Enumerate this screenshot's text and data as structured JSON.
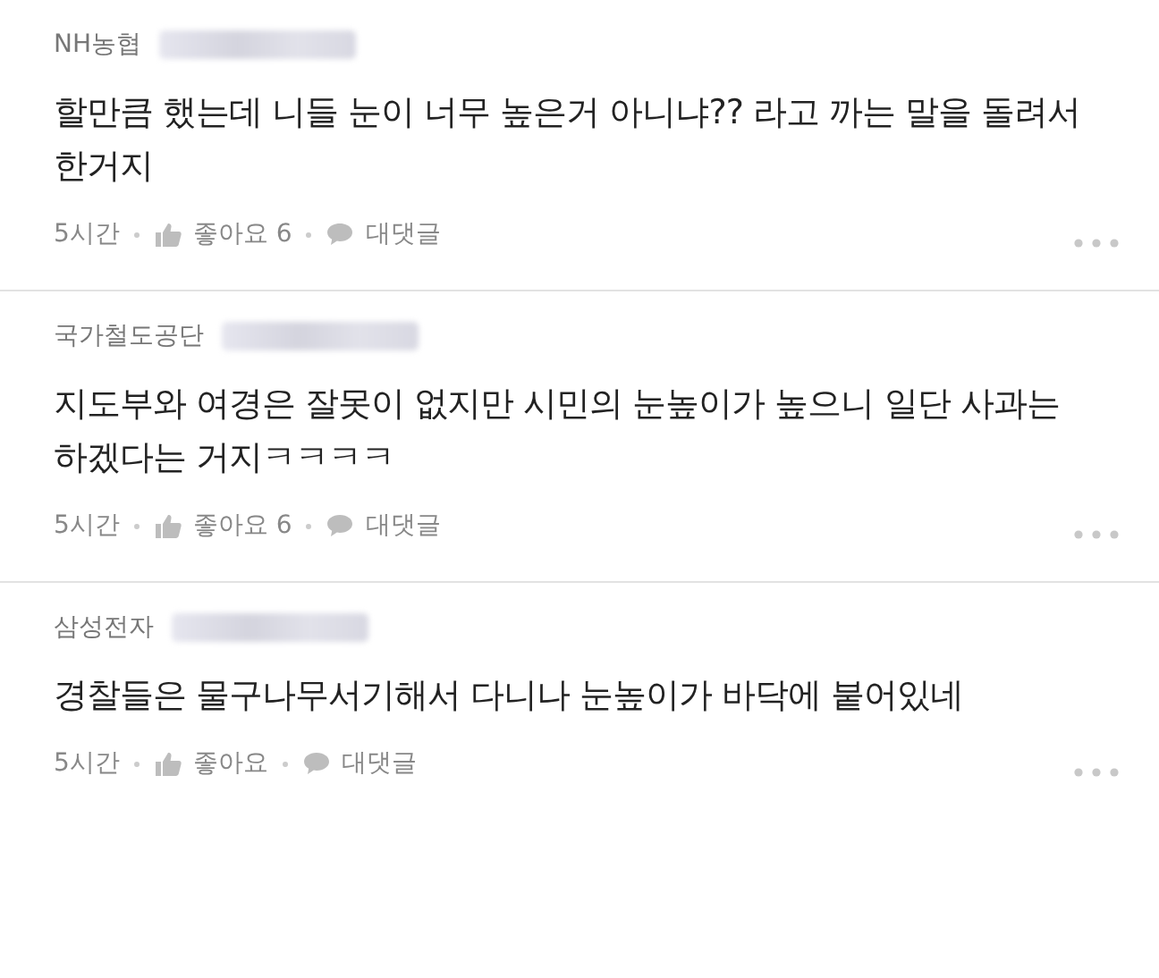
{
  "comments": [
    {
      "company": "NH농협",
      "text": "할만큼 했는데 니들 눈이 너무 높은거 아니냐?? 라고 까는 말을 돌려서 한거지",
      "time": "5시간",
      "likes": "좋아요 6",
      "reply": "대댓글"
    },
    {
      "company": "국가철도공단",
      "text": "지도부와 여경은 잘못이 없지만 시민의 눈높이가 높으니 일단 사과는 하겠다는 거지ㅋㅋㅋㅋ",
      "time": "5시간",
      "likes": "좋아요 6",
      "reply": "대댓글"
    },
    {
      "company": "삼성전자",
      "text": "경찰들은 물구나무서기해서 다니나 눈높이가 바닥에 붙어있네",
      "time": "5시간",
      "likes": "좋아요",
      "reply": "대댓글"
    }
  ]
}
